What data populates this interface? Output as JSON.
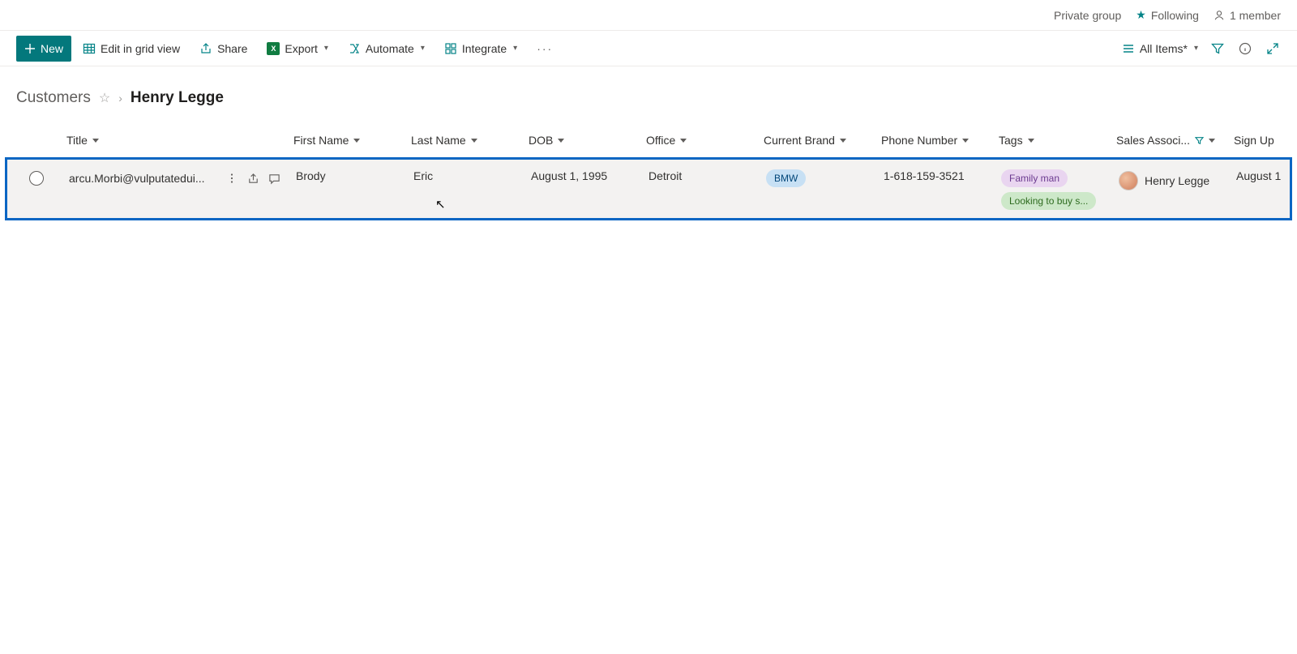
{
  "header": {
    "privacy": "Private group",
    "following_label": "Following",
    "member_count": "1 member"
  },
  "toolbar": {
    "new_label": "New",
    "edit_label": "Edit in grid view",
    "share_label": "Share",
    "export_label": "Export",
    "automate_label": "Automate",
    "integrate_label": "Integrate",
    "view_name": "All Items*"
  },
  "breadcrumb": {
    "root": "Customers",
    "current": "Henry Legge"
  },
  "columns": {
    "title": "Title",
    "first_name": "First Name",
    "last_name": "Last Name",
    "dob": "DOB",
    "office": "Office",
    "brand": "Current Brand",
    "phone": "Phone Number",
    "tags": "Tags",
    "associate": "Sales Associ...",
    "signup": "Sign Up"
  },
  "row": {
    "title": "arcu.Morbi@vulputatedui...",
    "first_name": "Brody",
    "last_name": "Eric",
    "dob": "August 1, 1995",
    "office": "Detroit",
    "brand": "BMW",
    "phone": "1-618-159-3521",
    "tags": [
      "Family man",
      "Looking to buy s..."
    ],
    "associate": "Henry Legge",
    "signup": "August 1"
  }
}
